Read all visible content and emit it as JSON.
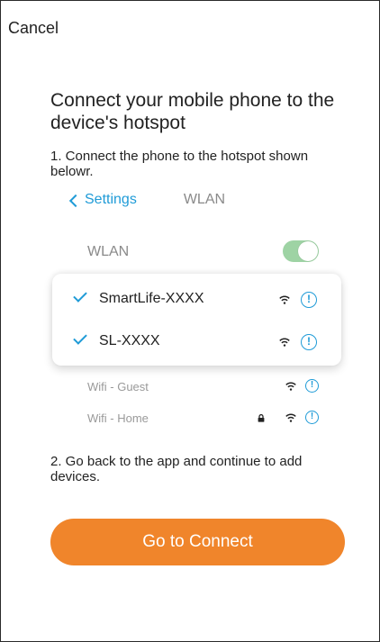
{
  "header": {
    "cancel_label": "Cancel"
  },
  "main": {
    "title": "Connect your mobile phone to the device's hotspot",
    "step1": "1. Connect the phone to the hotspot shown belowr.",
    "step2": "2. Go back to the app and continue to add devices.",
    "connect_button": "Go to Connect"
  },
  "illustration": {
    "nav_back_label": "Settings",
    "nav_title": "WLAN",
    "wlan_label": "WLAN",
    "wlan_enabled": true,
    "highlighted_networks": [
      {
        "name": "SmartLife-XXXX",
        "selected": true
      },
      {
        "name": "SL-XXXX",
        "selected": true
      }
    ],
    "other_networks": [
      {
        "name": "Wifi - Guest",
        "locked": false
      },
      {
        "name": "Wifi - Home",
        "locked": true
      }
    ],
    "info_glyph": "!"
  },
  "colors": {
    "accent_blue": "#1f9bd7",
    "button_orange": "#f0852b",
    "toggle_green": "#9ed3a4",
    "muted_text": "#8a8a8a"
  },
  "icons": {
    "check": "checkmark-icon",
    "wifi": "wifi-icon",
    "info": "info-icon",
    "lock": "lock-icon",
    "back": "chevron-left-icon"
  }
}
